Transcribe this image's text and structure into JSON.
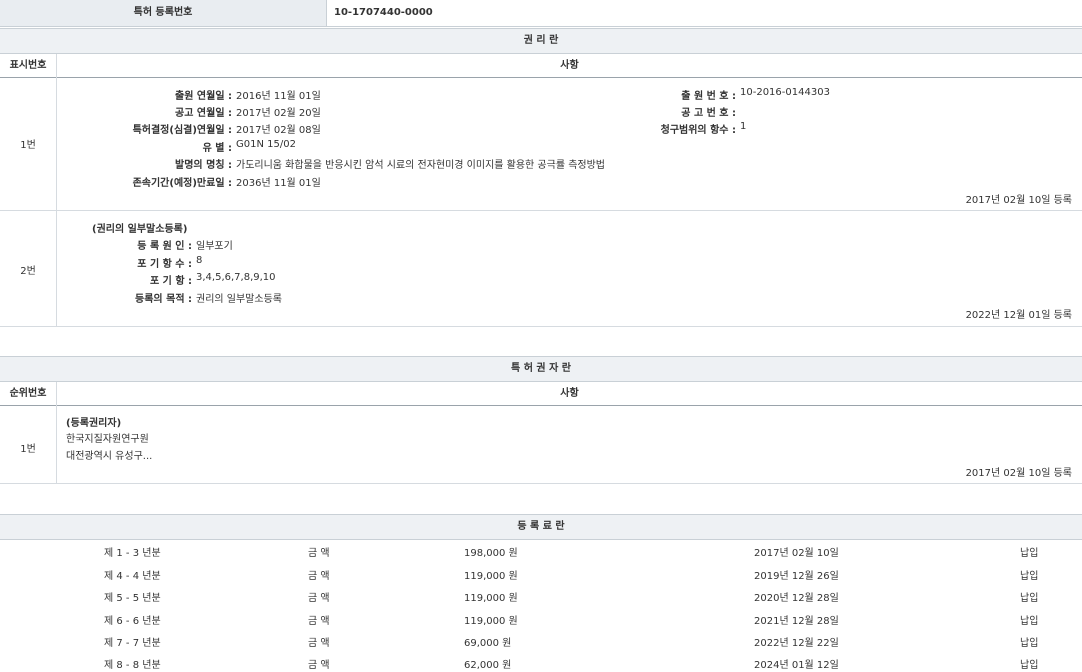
{
  "top": {
    "label": "특허 등록번호",
    "value": "10-1707440-0000"
  },
  "rights": {
    "title": "권 리 란",
    "col_num": "표시번호",
    "col_content": "사항",
    "entry1": {
      "num": "1번",
      "app_date_label": "출원 연월일 :",
      "app_date": "2016년 11월 01일",
      "app_no_label": "출 원 번 호 :",
      "app_no": "10-2016-0144303",
      "pub_date_label": "공고 연월일 :",
      "pub_date": "2017년 02월 20일",
      "pub_no_label": "공 고 번 호 :",
      "pub_no": "",
      "decision_label": "특허결정(심결)연월일 :",
      "decision": "2017년 02월 08일",
      "claims_label": "청구범위의 항수 :",
      "claims": "1",
      "class_label": "유 별 :",
      "class": "G01N 15/02",
      "title_label": "발명의 명칭 :",
      "invention": "가도리니움 화합물을 반응시킨 암석 시료의 전자현미경 이미지를 활용한 공극률 측정방법",
      "expiry_label": "존속기간(예정)만료일 :",
      "expiry": "2036년 11월 01일",
      "reg": "2017년 02월 10일 등록"
    },
    "entry2": {
      "num": "2번",
      "heading": "(권리의 일부말소등록)",
      "cause_label": "등 록 원 인 :",
      "cause": "일부포기",
      "count_label": "포 기 항 수 :",
      "count": "8",
      "items_label": "포 기 항 :",
      "items": "3,4,5,6,7,8,9,10",
      "purpose_label": "등록의 목적 :",
      "purpose": "권리의 일부말소등록",
      "reg": "2022년 12월 01일 등록"
    }
  },
  "holder": {
    "title": "특 허 권 자 란",
    "col_num": "순위번호",
    "col_content": "사항",
    "entry": {
      "num": "1번",
      "heading": "(등록권리자)",
      "name": "한국지질자원연구원",
      "addr": "대전광역시 유성구...",
      "reg": "2017년 02월 10일 등록"
    }
  },
  "fees": {
    "title": "등 록 료 란",
    "rows": [
      {
        "period": "제 1 - 3 년분",
        "label": "금 액",
        "amount": "198,000 원",
        "date": "2017년 02월 10일",
        "status": "납입"
      },
      {
        "period": "제 4 - 4 년분",
        "label": "금 액",
        "amount": "119,000 원",
        "date": "2019년 12월 26일",
        "status": "납입"
      },
      {
        "period": "제 5 - 5 년분",
        "label": "금 액",
        "amount": "119,000 원",
        "date": "2020년 12월 28일",
        "status": "납입"
      },
      {
        "period": "제 6 - 6 년분",
        "label": "금 액",
        "amount": "119,000 원",
        "date": "2021년 12월 28일",
        "status": "납입"
      },
      {
        "period": "제 7 - 7 년분",
        "label": "금 액",
        "amount": "69,000 원",
        "date": "2022년 12월 22일",
        "status": "납입"
      },
      {
        "period": "제 8 - 8 년분",
        "label": "금 액",
        "amount": "62,000 원",
        "date": "2024년 01월 12일",
        "status": "납입"
      }
    ]
  }
}
